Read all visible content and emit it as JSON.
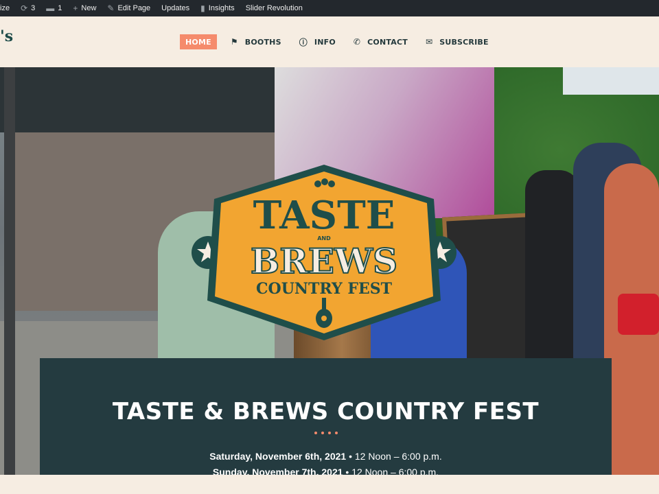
{
  "adminbar": {
    "customize": "ize",
    "updates_count": "3",
    "comments_count": "1",
    "new_label": "New",
    "edit_label": "Edit Page",
    "updates_label": "Updates",
    "insights_label": "Insights",
    "slider_label": "Slider Revolution"
  },
  "header": {
    "logo_fragment": "'s",
    "nav": [
      {
        "label": "HOME",
        "icon": "none"
      },
      {
        "label": "BOOTHS",
        "icon": "flag-icon"
      },
      {
        "label": "INFO",
        "icon": "info-icon"
      },
      {
        "label": "CONTACT",
        "icon": "phone-icon"
      },
      {
        "label": "SUBSCRIBE",
        "icon": "envelope-icon"
      }
    ]
  },
  "hero": {
    "logo": {
      "line1": "TASTE",
      "and": "AND",
      "line2": "BREWS",
      "line3": "COUNTRY FEST"
    },
    "panel": {
      "title": "TASTE & BREWS COUNTRY FEST",
      "date1_day": "Saturday, November 6th, 2021",
      "date1_time": " • 12 Noon – 6:00 p.m.",
      "date2_day": "Sunday, November 7th, 2021",
      "date2_time": " • 12 Noon – 6:00 p.m."
    }
  },
  "colors": {
    "adminbar_bg": "#23282d",
    "header_bg": "#f6ede2",
    "accent": "#f58b6c",
    "panel_bg": "#243b40",
    "logo_orange": "#f2a531",
    "logo_green": "#1f4e4a"
  }
}
